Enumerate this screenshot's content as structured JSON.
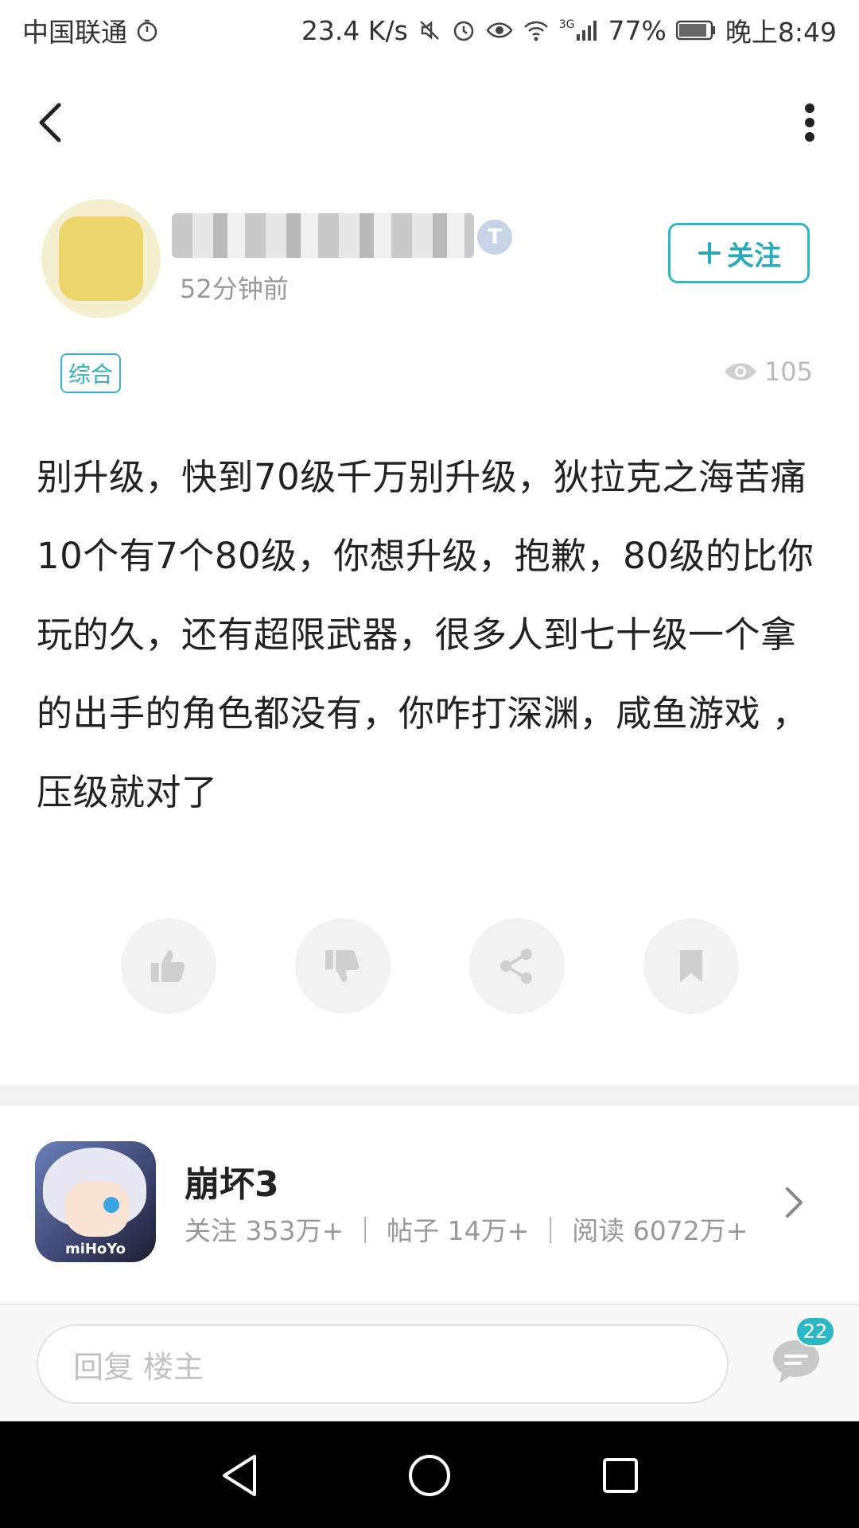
{
  "status_bar": {
    "carrier": "中国联通",
    "speed": "23.4 K/s",
    "network": "3G",
    "battery": "77%",
    "time": "晚上8:49"
  },
  "header": {
    "back_icon": "chevron-left-icon",
    "more_icon": "more-vertical-icon"
  },
  "author": {
    "level_badge": "T",
    "time_ago": "52分钟前",
    "follow_label": "关注"
  },
  "post": {
    "tag": "综合",
    "views": "105",
    "content": "别升级，快到70级千万别升级，狄拉克之海苦痛10个有7个80级，你想升级，抱歉，80级的比你玩的久，还有超限武器，很多人到七十级一个拿的出手的角色都没有，你咋打深渊，咸鱼游戏 ，压级就对了"
  },
  "actions": [
    "thumbs-up-icon",
    "thumbs-down-icon",
    "share-icon",
    "bookmark-icon"
  ],
  "forum": {
    "name": "崩坏3",
    "stats": "关注 353万+ ｜ 帖子 14万+ ｜ 阅读 6072万+",
    "icon_brand": "miHoYo"
  },
  "reply": {
    "placeholder": "回复  楼主",
    "comment_count": "22"
  },
  "colors": {
    "accent": "#2cb7c7",
    "text": "#222222",
    "muted": "#999999"
  }
}
